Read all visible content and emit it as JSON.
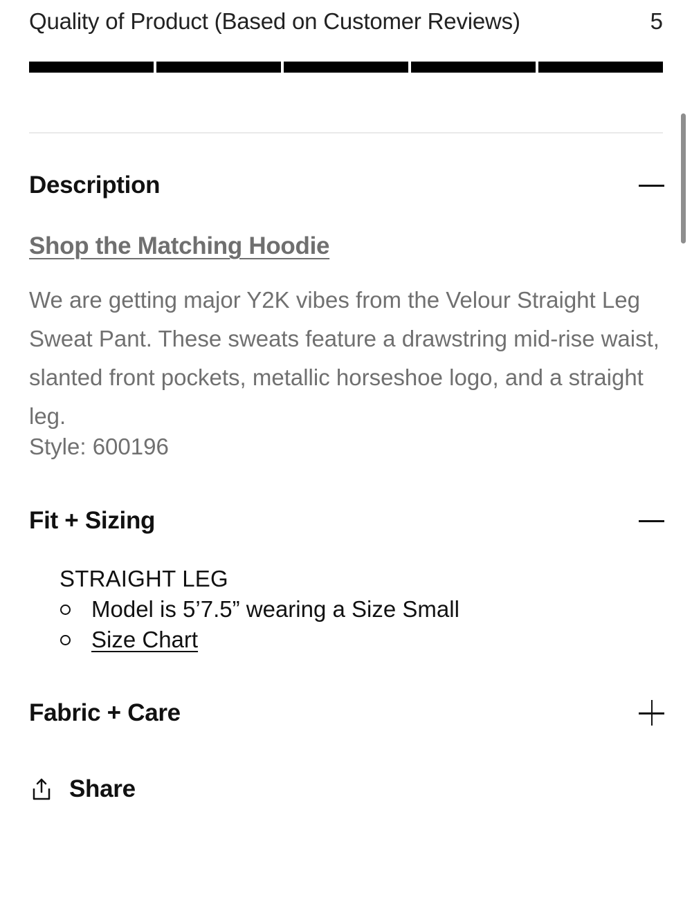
{
  "rating": {
    "label": "Quality of Product (Based on Customer Reviews)",
    "value": "5",
    "score_out_of_5": 5
  },
  "description": {
    "title": "Description",
    "toggle_icon": "minus-icon",
    "shop_link": "Shop the Matching Hoodie",
    "body": "We are getting major Y2K vibes from the Velour Straight Leg Sweat Pant. These sweats feature a drawstring mid-rise waist, slanted front pockets, metallic horseshoe logo, and a straight leg.",
    "style": "Style: 600196"
  },
  "fit_sizing": {
    "title": "Fit + Sizing",
    "toggle_icon": "minus-icon",
    "heading": "STRAIGHT LEG",
    "items": [
      {
        "label": "Model is 5’7.5” wearing a Size Small"
      },
      {
        "label": "Size Chart"
      }
    ]
  },
  "fabric_care": {
    "title": "Fabric + Care",
    "toggle_icon": "plus-icon"
  },
  "share": {
    "label": "Share",
    "icon": "share-icon"
  },
  "colors": {
    "text_primary": "#111111",
    "text_secondary": "#707070",
    "rating_fill": "#000000",
    "divider": "#e9e9e9"
  }
}
